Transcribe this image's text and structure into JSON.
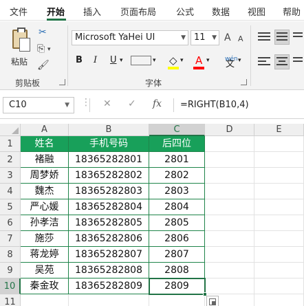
{
  "ribbon_tabs": [
    "文件",
    "开始",
    "插入",
    "页面布局",
    "公式",
    "数据",
    "视图",
    "帮助"
  ],
  "active_tab": "开始",
  "clipboard": {
    "paste_label": "粘贴",
    "group_label": "剪贴板"
  },
  "font": {
    "name": "Microsoft YaHei UI",
    "size": "11",
    "group_label": "字体",
    "bold": "B",
    "italic": "I",
    "underline": "U",
    "fill_icon": "◇",
    "font_color_icon": "A",
    "wen_icon": "wén",
    "grow_icon": "A",
    "shrink_icon": "A"
  },
  "colors": {
    "accent": "#217346",
    "header_fill": "#18a05a",
    "fill_color": "#ffff00",
    "font_color": "#ff0000"
  },
  "icons": {
    "cut": "✂",
    "copy": "⎘",
    "format_painter": "🖌",
    "cancel": "✕",
    "confirm": "✓"
  },
  "formula_bar": {
    "name_box": "C10",
    "fx": "fx",
    "formula": "=RIGHT(B10,4)"
  },
  "grid": {
    "columns": [
      "A",
      "B",
      "C",
      "D",
      "E"
    ],
    "rows": [
      "1",
      "2",
      "3",
      "4",
      "5",
      "6",
      "7",
      "8",
      "9",
      "10",
      "11"
    ],
    "headers": [
      "姓名",
      "手机号码",
      "后四位"
    ],
    "data": [
      [
        "褚融",
        "18365282801",
        "2801"
      ],
      [
        "周梦娇",
        "18365282802",
        "2802"
      ],
      [
        "魏杰",
        "18365282803",
        "2803"
      ],
      [
        "严心媛",
        "18365282804",
        "2804"
      ],
      [
        "孙孝洁",
        "18365282805",
        "2805"
      ],
      [
        "施莎",
        "18365282806",
        "2806"
      ],
      [
        "蒋龙婷",
        "18365282807",
        "2807"
      ],
      [
        "吴苑",
        "18365282808",
        "2808"
      ],
      [
        "秦金玫",
        "18365282809",
        "2809"
      ]
    ]
  }
}
